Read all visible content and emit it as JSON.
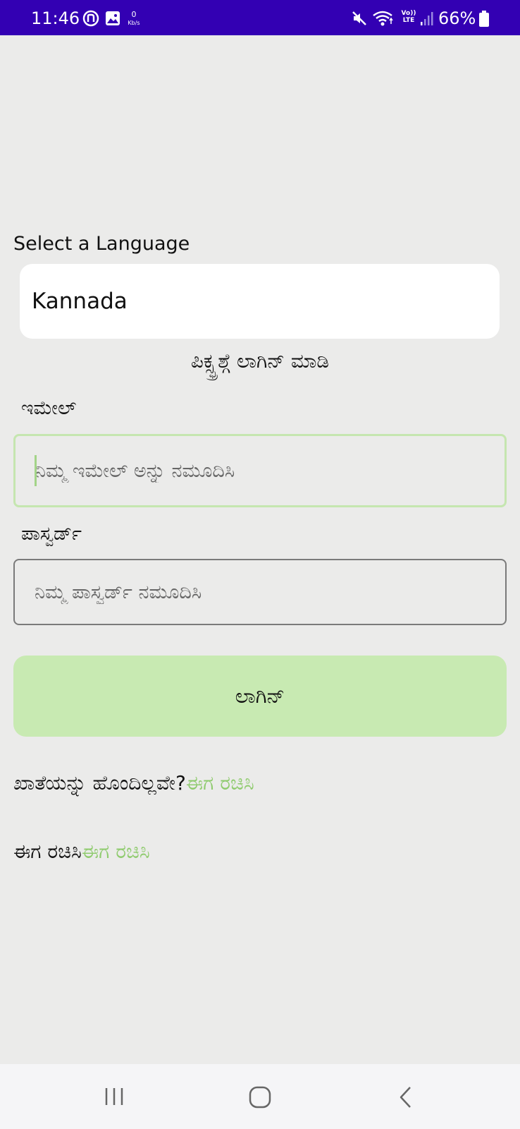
{
  "status_bar": {
    "time": "11:46",
    "net_speed": "0",
    "net_speed_unit": "Kb/s",
    "volte_top": "Vo))",
    "volte_bottom": "LTE",
    "battery": "66%",
    "bg_color": "#3300b3"
  },
  "language": {
    "label": "Select a Language",
    "selected": "Kannada"
  },
  "login": {
    "heading": "ಪಿಕ್ಸ್ಫ್ರಶ್ಗೆ ಲಾಗಿನ್ ಮಾಡಿ",
    "email_label": "ಇಮೇಲ್",
    "email_placeholder": "ನಿಮ್ಮ ಇಮೇಲ್ ಅನ್ನು ನಮೂದಿಸಿ",
    "password_label": "ಪಾಸ್ವರ್ಡ್",
    "password_placeholder": "ನಿಮ್ಮ ಪಾಸ್ವರ್ಡ್ ನಮೂದಿಸಿ",
    "button_label": "ಲಾಗಿನ್",
    "no_account_text": "ಖಾತೆಯನ್ನು ಹೊಂದಿಲ್ಲವೇ?",
    "no_account_link": "ಈಗ ರಚಿಸಿ",
    "create_text": "ಈಗ ರಚಿಸಿ",
    "create_link": "ಈಗ ರಚಿಸಿ"
  },
  "colors": {
    "accent_green": "#8fcb6e",
    "button_bg": "#c8eab2",
    "page_bg": "#ebebea"
  },
  "icons": {
    "status_left": [
      "app-notification-icon",
      "gallery-icon"
    ],
    "status_right": [
      "mute-icon",
      "wifi-icon",
      "signal-icon",
      "battery-icon"
    ],
    "nav": [
      "recent-apps-icon",
      "home-icon",
      "back-icon"
    ]
  }
}
